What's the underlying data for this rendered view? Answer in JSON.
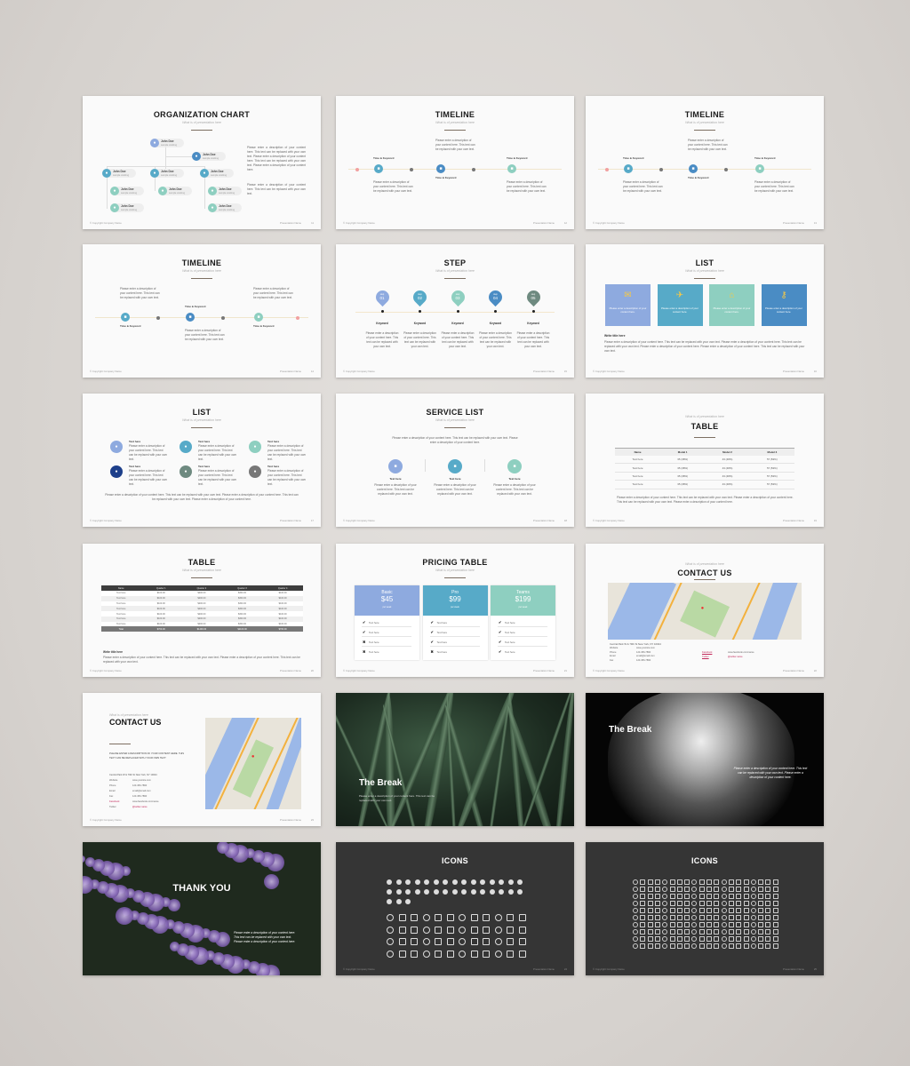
{
  "common": {
    "subtitle": "What is of presentation here",
    "footer_left": "© Copyright Company Name",
    "footer_right": "Presentation Name",
    "placeholder_short": "Please enter a description of your content here. This text can be replaced with your own text.",
    "placeholder_long": "Please enter a description of your content here. This text can be replaced with your own text. Please enter a description of your content here. This text can be replaced with your own text. Please enter a description of your content here.",
    "text_here": "Text here",
    "keyword": "Keyword",
    "time_keyword": "Time & Keyword",
    "write_title": "Write title here"
  },
  "colors": {
    "accent_rule": "#7d6f62",
    "blue_light": "#8eaadf",
    "teal": "#57aac8",
    "mint": "#8ecfc0",
    "blue": "#4a8cc4",
    "slate": "#6e8a80",
    "dark_bg": "#353535"
  },
  "slides": [
    {
      "type": "org",
      "title": "ORGANIZATION CHART",
      "page": "11",
      "nodes": [
        {
          "name": "John Doe",
          "role": "sample working"
        },
        {
          "name": "John Doe",
          "role": "sample working"
        },
        {
          "name": "John Doe",
          "role": "sample working"
        },
        {
          "name": "John Doe",
          "role": "sample working"
        },
        {
          "name": "John Doe",
          "role": "sample working"
        },
        {
          "name": "John Doe",
          "role": "sample working"
        },
        {
          "name": "John Doe",
          "role": "sample working"
        },
        {
          "name": "John Doe",
          "role": "sample working"
        },
        {
          "name": "John Doe",
          "role": "sample working"
        },
        {
          "name": "John Doe",
          "role": "sample working"
        }
      ]
    },
    {
      "type": "timeline",
      "title": "TIMELINE",
      "page": "12",
      "variant": "a"
    },
    {
      "type": "timeline",
      "title": "TIMELINE",
      "page": "13",
      "variant": "b"
    },
    {
      "type": "timeline",
      "title": "TIMELINE",
      "page": "14",
      "variant": "c"
    },
    {
      "type": "step",
      "title": "STEP",
      "page": "15",
      "step_label": "step",
      "steps": [
        "01",
        "02",
        "03",
        "04",
        "05"
      ]
    },
    {
      "type": "tiles",
      "title": "LIST",
      "page": "16",
      "tile_text": "Please enter a description of your content here.",
      "icons": [
        "pin-icon",
        "plane-icon",
        "house-icon",
        "key-icon"
      ]
    },
    {
      "type": "iconlist",
      "title": "LIST",
      "page": "17"
    },
    {
      "type": "service",
      "title": "SERVICE LIST",
      "page": "18",
      "intro": "Please enter a description of your content here. This text can be replaced with your own text. Please enter a description of your content here."
    },
    {
      "type": "table_models",
      "title": "TABLE",
      "page": "19",
      "headers": [
        "Name",
        "Model 1",
        "Model 2",
        "Model 3"
      ],
      "rows": [
        [
          "Text here",
          "35 (38%)",
          "43 (48%)",
          "57 (53%)"
        ],
        [
          "Text here",
          "35 (38%)",
          "43 (48%)",
          "57 (53%)"
        ],
        [
          "Text here",
          "35 (38%)",
          "43 (48%)",
          "57 (53%)"
        ],
        [
          "Text here",
          "35 (38%)",
          "43 (48%)",
          "57 (53%)"
        ]
      ]
    },
    {
      "type": "table_quarters",
      "title": "TABLE",
      "page": "20",
      "headers": [
        "Name",
        "Quarter 1",
        "Quarter 2",
        "Quarter 3",
        "Quarter 4"
      ],
      "rows": [
        [
          "Text here",
          "$100.00",
          "$200.00",
          "$300.00",
          "$100.00"
        ],
        [
          "Text here",
          "$100.00",
          "$200.00",
          "$300.00",
          "$100.00"
        ],
        [
          "Text here",
          "$100.00",
          "$200.00",
          "$300.00",
          "$100.00"
        ],
        [
          "Text here",
          "$100.00",
          "$200.00",
          "$300.00",
          "$100.00"
        ],
        [
          "Text here",
          "$100.00",
          "$200.00",
          "$300.00",
          "$100.00"
        ],
        [
          "Text here",
          "$100.00",
          "$200.00",
          "$300.00",
          "$100.00"
        ],
        [
          "Text here",
          "$100.00",
          "$200.00",
          "$300.00",
          "$100.00"
        ]
      ],
      "total": [
        "Total",
        "$700.00",
        "$1400.00",
        "$2100.00",
        "$700.00"
      ]
    },
    {
      "type": "pricing",
      "title": "PRICING TABLE",
      "page": "21",
      "plans": [
        {
          "name": "Basic",
          "price": "$45",
          "period": "per week",
          "features": [
            "check",
            "check",
            "cross",
            "cross"
          ]
        },
        {
          "name": "Pro",
          "price": "$99",
          "period": "per week",
          "features": [
            "check",
            "check",
            "check",
            "cross"
          ]
        },
        {
          "name": "Teams",
          "price": "$199",
          "period": "per week",
          "features": [
            "check",
            "check",
            "check",
            "check"
          ]
        }
      ]
    },
    {
      "type": "contact_top",
      "title": "CONTACT US",
      "page": "22",
      "address": "Central Park W & 79th St New York, NY 10024",
      "fields": [
        [
          "Website",
          "www.yoursite.com"
        ],
        [
          "Phone",
          "123-456-7890"
        ],
        [
          "Email",
          "email@email.com"
        ],
        [
          "Fax",
          "123-456-7890"
        ]
      ],
      "social": [
        [
          "Facebook",
          "www.facebook.com/name"
        ],
        [
          "Twitter",
          "@twitter.name"
        ]
      ]
    },
    {
      "type": "contact_side",
      "title": "CONTACT US",
      "page": "23",
      "intro": "PLEASE ENTER A DESCRIPTION OF YOUR CONTENT HERE. THIS TEXT CAN BE REPLACED WITH YOUR OWN TEXT",
      "address": "Central Park W & 79th St New York, NY 10024",
      "fields": [
        [
          "Website",
          "www.yoursite.com"
        ],
        [
          "Phone",
          "123-456-7890"
        ],
        [
          "Email",
          "email@email.com"
        ],
        [
          "Fax",
          "123-456-7890"
        ],
        [
          "Facebook",
          "www.facebook.com/name"
        ],
        [
          "Twitter",
          "@twitter.name"
        ]
      ]
    },
    {
      "type": "break_leaves",
      "title": "The Break",
      "text": "Please enter a description of your content here. This text can be replaced with your own text."
    },
    {
      "type": "break_hands",
      "title": "The Break",
      "text": "Please enter a description of your content here. This text can be replaced with your own text. Please enter a description of your content here."
    },
    {
      "type": "thanks",
      "title": "THANK YOU",
      "text": "Please enter a description of your content here. This text can be replaced with your own text. Please enter a description of your content here."
    },
    {
      "type": "icons",
      "title": "ICONS",
      "page": "24",
      "variant": "a"
    },
    {
      "type": "icons",
      "title": "ICONS",
      "page": "25",
      "variant": "b"
    }
  ]
}
